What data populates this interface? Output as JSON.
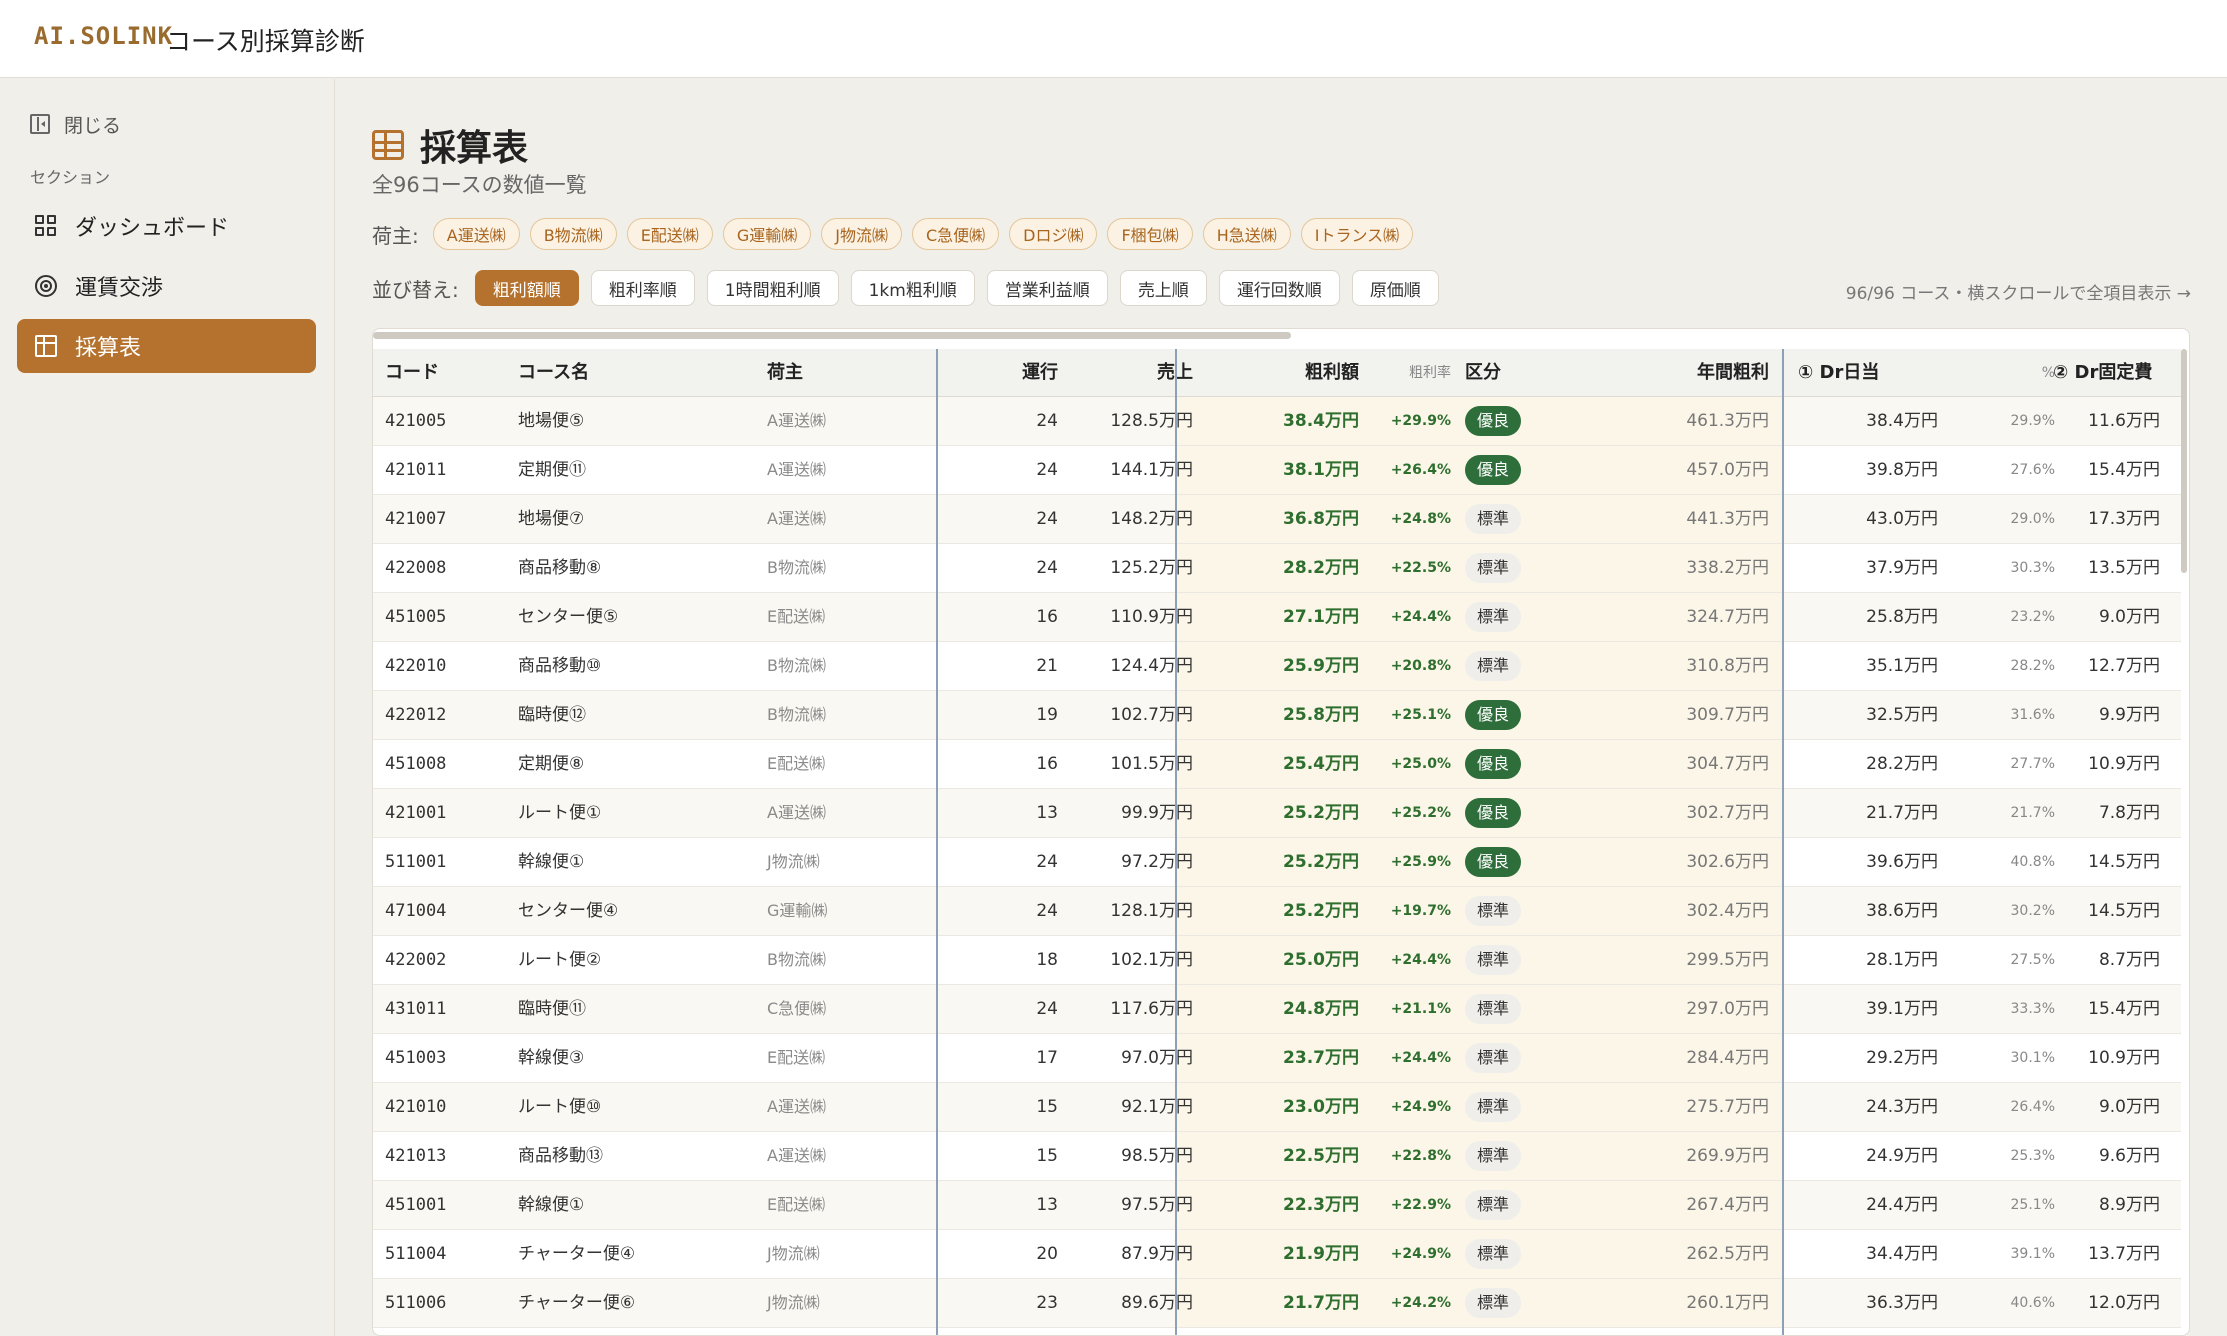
{
  "header": {
    "logo": "AI.SOLINK",
    "title": "コース別採算診断"
  },
  "sidebar": {
    "close_label": "閉じる",
    "section_label": "セクション",
    "items": [
      {
        "label": "ダッシュボード",
        "icon": "dashboard-icon"
      },
      {
        "label": "運賃交渉",
        "icon": "target-icon"
      },
      {
        "label": "採算表",
        "icon": "table-icon",
        "active": true
      }
    ]
  },
  "page": {
    "title": "採算表",
    "subtitle": "全96コースの数値一覧",
    "filter_label": "荷主:",
    "shippers": [
      "A運送㈱",
      "B物流㈱",
      "E配送㈱",
      "G運輸㈱",
      "J物流㈱",
      "C急便㈱",
      "Dロジ㈱",
      "F梱包㈱",
      "H急送㈱",
      "Iトランス㈱"
    ],
    "sort_label": "並び替え:",
    "sort_options": [
      "粗利額順",
      "粗利率順",
      "1時間粗利順",
      "1km粗利順",
      "営業利益順",
      "売上順",
      "運行回数順",
      "原価順"
    ],
    "active_sort": "粗利額順",
    "count_note": "96/96 コース・横スクロールで全項目表示 →"
  },
  "table": {
    "columns": {
      "code": "コード",
      "name": "コース名",
      "shipper": "荷主",
      "runs": "運行",
      "sales": "売上",
      "gross": "粗利額",
      "gross_rate": "粗利率",
      "category": "区分",
      "annual": "年間粗利",
      "dr_daily": "① Dr日当",
      "dr_daily_pct": "%",
      "dr_fixed": "② Dr固定費"
    },
    "rows": [
      {
        "code": "421005",
        "name": "地場便⑤",
        "shipper": "A運送㈱",
        "runs": "24",
        "sales": "128.5万円",
        "gross": "38.4万円",
        "rate": "+29.9%",
        "category": "優良",
        "annual": "461.3万円",
        "dr": "38.4万円",
        "pct": "29.9%",
        "fixed": "11.6万円"
      },
      {
        "code": "421011",
        "name": "定期便⑪",
        "shipper": "A運送㈱",
        "runs": "24",
        "sales": "144.1万円",
        "gross": "38.1万円",
        "rate": "+26.4%",
        "category": "優良",
        "annual": "457.0万円",
        "dr": "39.8万円",
        "pct": "27.6%",
        "fixed": "15.4万円"
      },
      {
        "code": "421007",
        "name": "地場便⑦",
        "shipper": "A運送㈱",
        "runs": "24",
        "sales": "148.2万円",
        "gross": "36.8万円",
        "rate": "+24.8%",
        "category": "標準",
        "annual": "441.3万円",
        "dr": "43.0万円",
        "pct": "29.0%",
        "fixed": "17.3万円"
      },
      {
        "code": "422008",
        "name": "商品移動⑧",
        "shipper": "B物流㈱",
        "runs": "24",
        "sales": "125.2万円",
        "gross": "28.2万円",
        "rate": "+22.5%",
        "category": "標準",
        "annual": "338.2万円",
        "dr": "37.9万円",
        "pct": "30.3%",
        "fixed": "13.5万円"
      },
      {
        "code": "451005",
        "name": "センター便⑤",
        "shipper": "E配送㈱",
        "runs": "16",
        "sales": "110.9万円",
        "gross": "27.1万円",
        "rate": "+24.4%",
        "category": "標準",
        "annual": "324.7万円",
        "dr": "25.8万円",
        "pct": "23.2%",
        "fixed": "9.0万円"
      },
      {
        "code": "422010",
        "name": "商品移動⑩",
        "shipper": "B物流㈱",
        "runs": "21",
        "sales": "124.4万円",
        "gross": "25.9万円",
        "rate": "+20.8%",
        "category": "標準",
        "annual": "310.8万円",
        "dr": "35.1万円",
        "pct": "28.2%",
        "fixed": "12.7万円"
      },
      {
        "code": "422012",
        "name": "臨時便⑫",
        "shipper": "B物流㈱",
        "runs": "19",
        "sales": "102.7万円",
        "gross": "25.8万円",
        "rate": "+25.1%",
        "category": "優良",
        "annual": "309.7万円",
        "dr": "32.5万円",
        "pct": "31.6%",
        "fixed": "9.9万円"
      },
      {
        "code": "451008",
        "name": "定期便⑧",
        "shipper": "E配送㈱",
        "runs": "16",
        "sales": "101.5万円",
        "gross": "25.4万円",
        "rate": "+25.0%",
        "category": "優良",
        "annual": "304.7万円",
        "dr": "28.2万円",
        "pct": "27.7%",
        "fixed": "10.9万円"
      },
      {
        "code": "421001",
        "name": "ルート便①",
        "shipper": "A運送㈱",
        "runs": "13",
        "sales": "99.9万円",
        "gross": "25.2万円",
        "rate": "+25.2%",
        "category": "優良",
        "annual": "302.7万円",
        "dr": "21.7万円",
        "pct": "21.7%",
        "fixed": "7.8万円"
      },
      {
        "code": "511001",
        "name": "幹線便①",
        "shipper": "J物流㈱",
        "runs": "24",
        "sales": "97.2万円",
        "gross": "25.2万円",
        "rate": "+25.9%",
        "category": "優良",
        "annual": "302.6万円",
        "dr": "39.6万円",
        "pct": "40.8%",
        "fixed": "14.5万円"
      },
      {
        "code": "471004",
        "name": "センター便④",
        "shipper": "G運輸㈱",
        "runs": "24",
        "sales": "128.1万円",
        "gross": "25.2万円",
        "rate": "+19.7%",
        "category": "標準",
        "annual": "302.4万円",
        "dr": "38.6万円",
        "pct": "30.2%",
        "fixed": "14.5万円"
      },
      {
        "code": "422002",
        "name": "ルート便②",
        "shipper": "B物流㈱",
        "runs": "18",
        "sales": "102.1万円",
        "gross": "25.0万円",
        "rate": "+24.4%",
        "category": "標準",
        "annual": "299.5万円",
        "dr": "28.1万円",
        "pct": "27.5%",
        "fixed": "8.7万円"
      },
      {
        "code": "431011",
        "name": "臨時便⑪",
        "shipper": "C急便㈱",
        "runs": "24",
        "sales": "117.6万円",
        "gross": "24.8万円",
        "rate": "+21.1%",
        "category": "標準",
        "annual": "297.0万円",
        "dr": "39.1万円",
        "pct": "33.3%",
        "fixed": "15.4万円"
      },
      {
        "code": "451003",
        "name": "幹線便③",
        "shipper": "E配送㈱",
        "runs": "17",
        "sales": "97.0万円",
        "gross": "23.7万円",
        "rate": "+24.4%",
        "category": "標準",
        "annual": "284.4万円",
        "dr": "29.2万円",
        "pct": "30.1%",
        "fixed": "10.9万円"
      },
      {
        "code": "421010",
        "name": "ルート便⑩",
        "shipper": "A運送㈱",
        "runs": "15",
        "sales": "92.1万円",
        "gross": "23.0万円",
        "rate": "+24.9%",
        "category": "標準",
        "annual": "275.7万円",
        "dr": "24.3万円",
        "pct": "26.4%",
        "fixed": "9.0万円"
      },
      {
        "code": "421013",
        "name": "商品移動⑬",
        "shipper": "A運送㈱",
        "runs": "15",
        "sales": "98.5万円",
        "gross": "22.5万円",
        "rate": "+22.8%",
        "category": "標準",
        "annual": "269.9万円",
        "dr": "24.9万円",
        "pct": "25.3%",
        "fixed": "9.6万円"
      },
      {
        "code": "451001",
        "name": "幹線便①",
        "shipper": "E配送㈱",
        "runs": "13",
        "sales": "97.5万円",
        "gross": "22.3万円",
        "rate": "+22.9%",
        "category": "標準",
        "annual": "267.4万円",
        "dr": "24.4万円",
        "pct": "25.1%",
        "fixed": "8.9万円"
      },
      {
        "code": "511004",
        "name": "チャーター便④",
        "shipper": "J物流㈱",
        "runs": "20",
        "sales": "87.9万円",
        "gross": "21.9万円",
        "rate": "+24.9%",
        "category": "標準",
        "annual": "262.5万円",
        "dr": "34.4万円",
        "pct": "39.1%",
        "fixed": "13.7万円"
      },
      {
        "code": "511006",
        "name": "チャーター便⑥",
        "shipper": "J物流㈱",
        "runs": "23",
        "sales": "89.6万円",
        "gross": "21.7万円",
        "rate": "+24.2%",
        "category": "標準",
        "annual": "260.1万円",
        "dr": "36.3万円",
        "pct": "40.6%",
        "fixed": "12.0万円"
      }
    ]
  },
  "colors": {
    "accent": "#b5722e",
    "good_badge": "#2e6e3a",
    "gross_text": "#2e6e2e"
  }
}
